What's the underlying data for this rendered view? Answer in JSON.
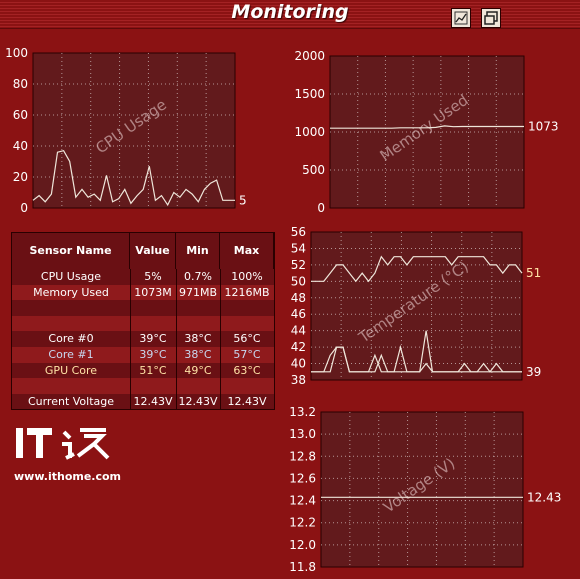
{
  "header": {
    "title": "Monitoring",
    "chart_button_icon": "line-chart-icon",
    "window_button_icon": "restore-window-icon"
  },
  "colors": {
    "background": "#8b1213",
    "plot_background": "#621a1c",
    "line": "#efe6da",
    "temp_label": "#ffe2a6"
  },
  "table": {
    "headers": [
      "Sensor Name",
      "Value",
      "Min",
      "Max"
    ],
    "rows": [
      {
        "name": "CPU Usage",
        "value": "5%",
        "min": "0.7%",
        "max": "100%",
        "color": "#ffffff",
        "bg": "#6a1014"
      },
      {
        "name": "Memory Used",
        "value": "1073M",
        "min": "971MB",
        "max": "1216MB",
        "color": "#ffffff",
        "bg": "#8f1a1c"
      },
      {
        "name": "",
        "value": "",
        "min": "",
        "max": "",
        "color": "#ffffff",
        "bg": "#6a1014"
      },
      {
        "name": "",
        "value": "",
        "min": "",
        "max": "",
        "color": "#ffffff",
        "bg": "#8f1a1c"
      },
      {
        "name": "Core #0",
        "value": "39°C",
        "min": "38°C",
        "max": "56°C",
        "color": "#ffffff",
        "bg": "#6a1014"
      },
      {
        "name": "Core #1",
        "value": "39°C",
        "min": "38°C",
        "max": "57°C",
        "color": "#c8d8f0",
        "bg": "#8f1a1c"
      },
      {
        "name": "GPU Core",
        "value": "51°C",
        "min": "49°C",
        "max": "63°C",
        "color": "#ffe2a6",
        "bg": "#6a1014"
      },
      {
        "name": "",
        "value": "",
        "min": "",
        "max": "",
        "color": "#ffffff",
        "bg": "#8f1a1c"
      },
      {
        "name": "Current Voltage",
        "value": "12.43V",
        "min": "12.43V",
        "max": "12.43V",
        "color": "#ffffff",
        "bg": "#6a1014"
      }
    ]
  },
  "logo": {
    "text": "IT之家",
    "url": "www.ithome.com"
  },
  "chart_data": [
    {
      "type": "line",
      "title": "CPU Usage",
      "ylim": [
        0,
        100
      ],
      "yticks": [
        0,
        20,
        40,
        60,
        80,
        100
      ],
      "current_label": "5",
      "series": [
        {
          "values": [
            5,
            8,
            4,
            9,
            36,
            37,
            30,
            7,
            12,
            7,
            9,
            5,
            21,
            4,
            6,
            12,
            3,
            8,
            12,
            27,
            5,
            8,
            2,
            10,
            7,
            12,
            9,
            4,
            12,
            16,
            18,
            5,
            5,
            5
          ]
        }
      ]
    },
    {
      "type": "line",
      "title": "Memory Used",
      "ylim": [
        0,
        2000
      ],
      "yticks": [
        0,
        500,
        1000,
        1500,
        2000
      ],
      "current_label": "1073",
      "series": [
        {
          "values": [
            1050,
            1050,
            1050,
            1050,
            1050,
            1050,
            1050,
            1050,
            1055,
            1055,
            1055,
            1055,
            1060,
            1080,
            1070,
            1073,
            1073,
            1073,
            1073,
            1073,
            1073,
            1073,
            1073
          ]
        }
      ]
    },
    {
      "type": "line",
      "title": "Temperature (°C)",
      "ylim": [
        38,
        56
      ],
      "yticks": [
        38,
        40,
        42,
        44,
        46,
        48,
        50,
        52,
        54,
        56
      ],
      "current_label": "51",
      "secondary_label": "39",
      "series": [
        {
          "values": [
            50,
            50,
            50,
            51,
            52,
            52,
            51,
            50,
            51,
            50,
            51,
            53,
            52,
            53,
            53,
            52,
            53,
            53,
            53,
            53,
            53,
            53,
            52,
            53,
            53,
            53,
            53,
            53,
            52,
            52,
            51,
            52,
            52,
            51
          ]
        },
        {
          "values": [
            39,
            39,
            39,
            41,
            42,
            42,
            39,
            39,
            39,
            39,
            39,
            41,
            39,
            39,
            42,
            39,
            39,
            39,
            40,
            39,
            39,
            39,
            39,
            39,
            39,
            39,
            39,
            39,
            39,
            39,
            39,
            39,
            39,
            39
          ]
        },
        {
          "values": [
            39,
            39,
            39,
            39,
            42,
            42,
            39,
            39,
            39,
            39,
            41,
            39,
            39,
            39,
            39,
            39,
            39,
            39,
            44,
            39,
            39,
            39,
            39,
            39,
            40,
            39,
            39,
            40,
            39,
            40,
            39,
            39,
            39,
            39
          ]
        }
      ]
    },
    {
      "type": "line",
      "title": "Voltage (V)",
      "ylim": [
        11.8,
        13.2
      ],
      "yticks": [
        11.8,
        12.0,
        12.2,
        12.4,
        12.6,
        12.8,
        13.0,
        13.2
      ],
      "current_label": "12.43",
      "series": [
        {
          "values": [
            12.43,
            12.43,
            12.43,
            12.43,
            12.43,
            12.43,
            12.43,
            12.43,
            12.43,
            12.43,
            12.43,
            12.43
          ]
        }
      ]
    }
  ]
}
